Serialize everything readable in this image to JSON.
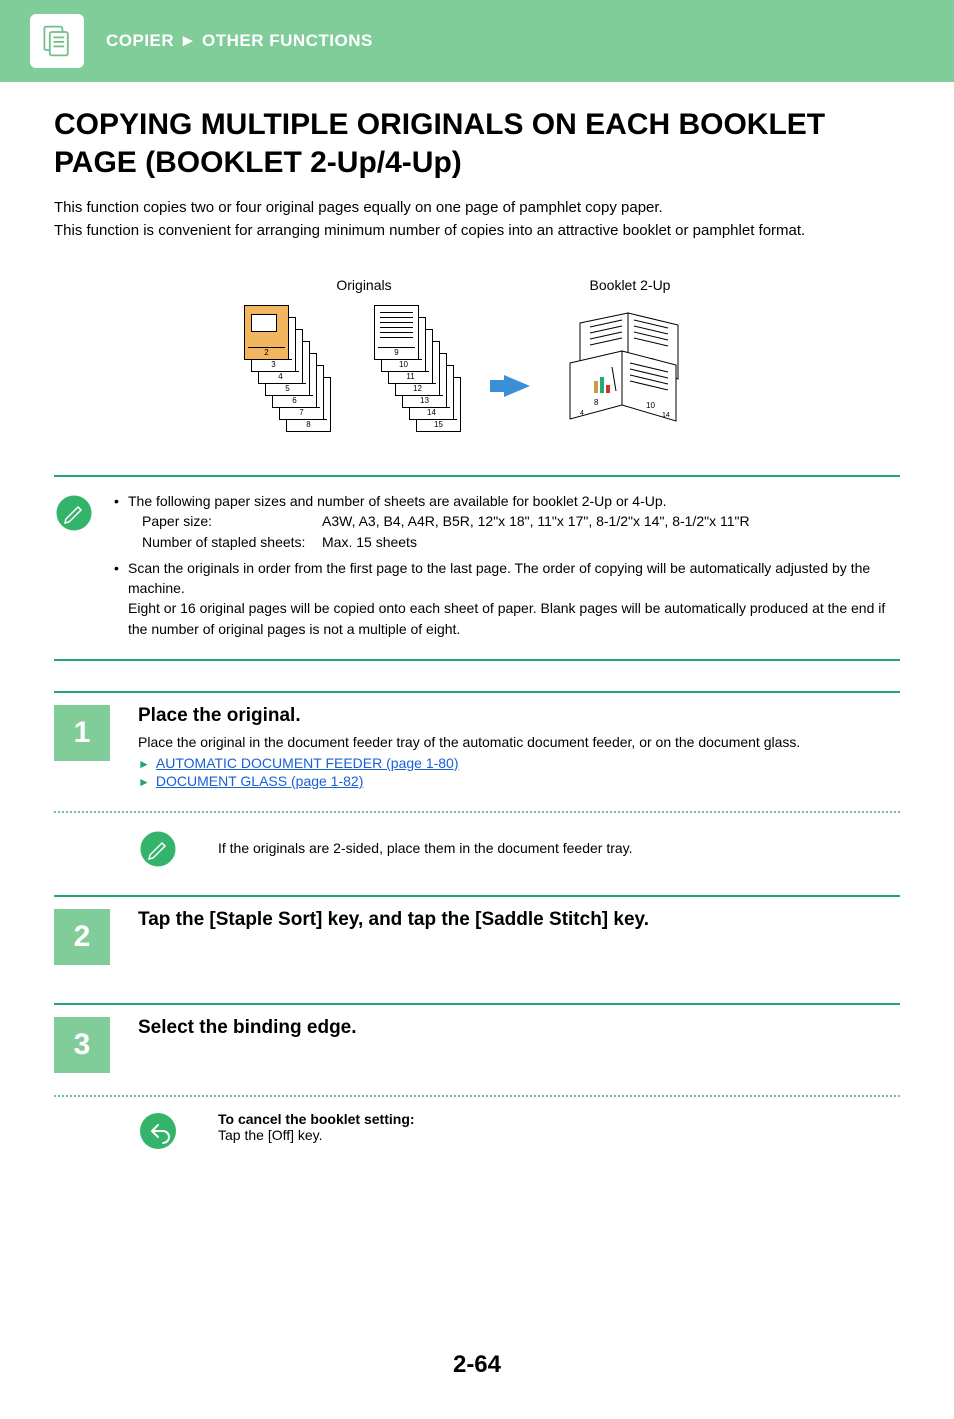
{
  "breadcrumb": {
    "section": "COPIER",
    "sep": "►",
    "page": "OTHER FUNCTIONS"
  },
  "title": "COPYING MULTIPLE ORIGINALS ON EACH BOOKLET PAGE (BOOKLET 2-Up/4-Up)",
  "intro": {
    "p1": "This function copies two or four original pages equally on one page of pamphlet copy paper.",
    "p2": "This function is convenient for arranging minimum number of copies into an attractive booklet or pamphlet format."
  },
  "diagram": {
    "originals_label": "Originals",
    "booklet_label": "Booklet 2-Up",
    "stack_a_nums": [
      "2",
      "3",
      "4",
      "5",
      "6",
      "7",
      "8"
    ],
    "stack_b_nums": [
      "9",
      "10",
      "11",
      "12",
      "13",
      "14",
      "15"
    ]
  },
  "info_bullets": {
    "b1": "The following paper sizes and number of sheets are available for booklet 2-Up or 4-Up.",
    "paper_label": "Paper size:",
    "paper_value": "A3W, A3, B4, A4R, B5R, 12\"x 18\", 11\"x 17\", 8-1/2\"x 14\", 8-1/2\"x 11\"R",
    "sheets_label": "Number of stapled sheets:",
    "sheets_value": "Max. 15 sheets",
    "b2": "Scan the originals in order from the first page to the last page. The order of copying will be automatically adjusted by the machine.",
    "b2_extra": "Eight or 16 original pages will be copied onto each sheet of paper. Blank pages will be automatically produced at the end if the number of original pages is not a multiple of eight."
  },
  "step1": {
    "num": "1",
    "title": "Place the original.",
    "text": "Place the original in the document feeder tray of the automatic document feeder, or on the document glass.",
    "link1": "AUTOMATIC DOCUMENT FEEDER (page 1-80)",
    "link2": "DOCUMENT GLASS (page 1-82)",
    "note": "If the originals are 2-sided, place them in the document feeder tray."
  },
  "step2": {
    "num": "2",
    "title": "Tap the [Staple Sort] key, and tap the [Saddle Stitch] key."
  },
  "step3": {
    "num": "3",
    "title": "Select the binding edge.",
    "cancel_title": "To cancel the booklet setting:",
    "cancel_text": "Tap the [Off] key."
  },
  "page_number": "2-64"
}
